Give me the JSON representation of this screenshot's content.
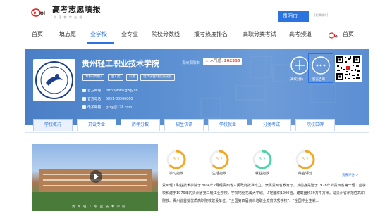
{
  "header": {
    "brand_title": "高考志愿填报",
    "brand_subtitle": "中 国 教 育 在 线",
    "city_button": "贵阳市",
    "city_switch": "[切换城市]",
    "brand_color": "#2b73de"
  },
  "nav": {
    "items": [
      "首页",
      "填志愿",
      "查学校",
      "查专业",
      "院校分数线",
      "报考热度排名",
      "高职分类考试",
      "高考频道"
    ],
    "active": "查学校",
    "home_label": "首页"
  },
  "school": {
    "name": "贵州轻工职业技术学院",
    "city": "贵州贵阳市",
    "popularity_label": "人气值:",
    "popularity_value": "202335",
    "tags": [
      "专科 (高职)",
      "理工类",
      "公办",
      "现代学徒制试点院校"
    ],
    "website_label": "官方网站：",
    "website": "http://www.gzqy.cn",
    "phone_label": "官方电话：",
    "phone": "0851-88506060",
    "email_label": "电子邮箱：",
    "email": "gzqy@126.com",
    "actions": {
      "compare_label": "高校对比",
      "consult_label": "留言咨询"
    }
  },
  "tabs": [
    "学校概况",
    "开设专业",
    "历年分数",
    "招生快讯",
    "学校就业",
    "分类考试",
    "院校口碑"
  ],
  "active_tab": "学校概况",
  "campus": {
    "caption": "贵 州 轻 工 职 业 技 术 学 院"
  },
  "stats": [
    {
      "label": "学习指数",
      "value": "3.2",
      "color": "#f5a623"
    },
    {
      "label": "生活指数",
      "value": "3.2",
      "color": "#f5a623"
    },
    {
      "label": "就业指数",
      "value": "3.2",
      "color": "#4cd3a7"
    },
    {
      "label": "综合评分",
      "value": "3.2",
      "color": "#f5a623"
    }
  ],
  "feedback_link": "我要评分 >",
  "description": "贵州轻工职业技术学院于2004年2月经贵州省人民政府批准成立，隶属贵州省教育厅，其前身是建于1978年的贵州省第一轻工业学校和建于1979年的贵州省第二轻工业学校。学院地处花溪大学城，占地面积1200亩，建筑面积39万平方米。是贵州省示范性高职院校、贵州省首批优质高职院校建设单位、“全国第四届黄炎培职业教育优秀学校”、“全国毕业生就..."
}
